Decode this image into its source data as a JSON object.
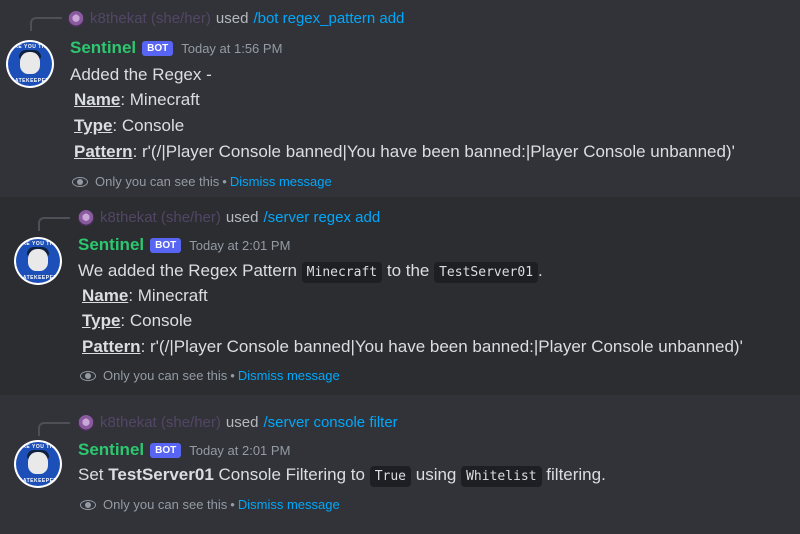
{
  "messages": [
    {
      "reply": {
        "user": "k8thekat (she/her)",
        "used": "used",
        "command": "/bot regex_pattern add"
      },
      "author": "Sentinel",
      "tag": "BOT",
      "timestamp": "Today at 1:56 PM",
      "intro": "Added the Regex -",
      "fields": [
        {
          "label": "Name",
          "value": ": Minecraft"
        },
        {
          "label": "Type",
          "value": ": Console"
        },
        {
          "label": "Pattern",
          "value": ": r'(/|Player Console banned|You have been banned:|Player Console unbanned)'"
        }
      ],
      "ephemeral": {
        "text": "Only you can see this",
        "dot": "•",
        "dismiss": "Dismiss message"
      }
    },
    {
      "reply": {
        "user": "k8thekat (she/her)",
        "used": "used",
        "command": "/server regex add"
      },
      "author": "Sentinel",
      "tag": "BOT",
      "timestamp": "Today at 2:01 PM",
      "intro_parts": [
        "We added the Regex Pattern ",
        "Minecraft",
        " to the ",
        "TestServer01",
        "."
      ],
      "fields": [
        {
          "label": "Name",
          "value": ": Minecraft"
        },
        {
          "label": "Type",
          "value": ": Console"
        },
        {
          "label": "Pattern",
          "value": ": r'(/|Player Console banned|You have been banned:|Player Console unbanned)'"
        }
      ],
      "ephemeral": {
        "text": "Only you can see this",
        "dot": "•",
        "dismiss": "Dismiss message"
      }
    },
    {
      "reply": {
        "user": "k8thekat (she/her)",
        "used": "used",
        "command": "/server console filter"
      },
      "author": "Sentinel",
      "tag": "BOT",
      "timestamp": "Today at 2:01 PM",
      "body_parts": [
        "Set ",
        "TestServer01",
        " Console Filtering to ",
        "True",
        " using ",
        "Whitelist",
        " filtering."
      ],
      "ephemeral": {
        "text": "Only you can see this",
        "dot": "•",
        "dismiss": "Dismiss message"
      }
    }
  ],
  "avatar_text": {
    "top": "ARE YOU THE",
    "bottom": "GATEKEEPER"
  },
  "colors": {
    "bot_name": "#2dc770",
    "bot_tag": "#5865f2",
    "link": "#00a8fc",
    "background": "#313338"
  }
}
